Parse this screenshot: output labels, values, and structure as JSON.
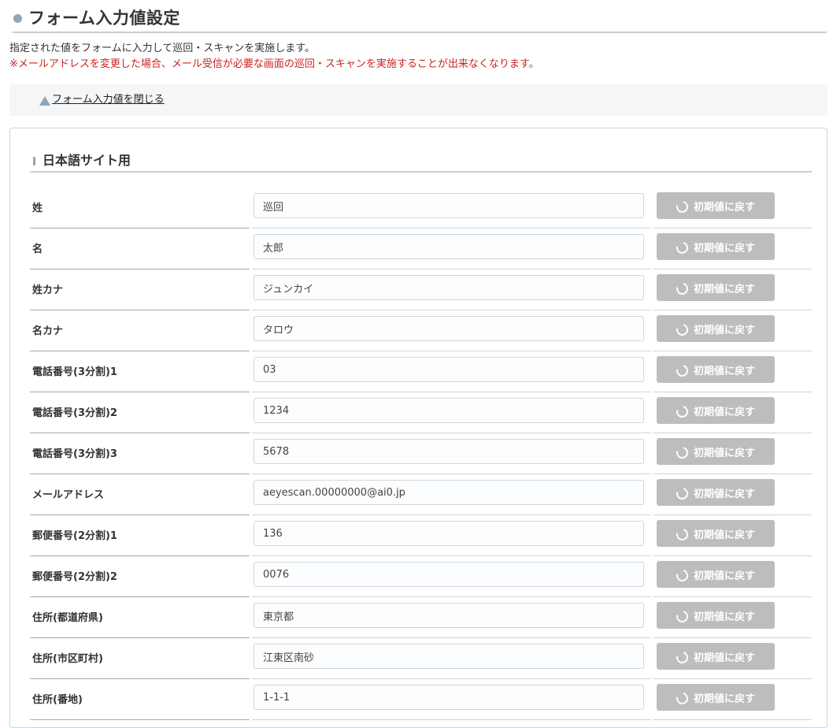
{
  "header": {
    "title": "フォーム入力値設定"
  },
  "description": "指定された値をフォームに入力して巡回・スキャンを実施します。",
  "warning": "※メールアドレスを変更した場合、メール受信が必要な画面の巡回・スキャンを実施することが出来なくなります。",
  "toggle": {
    "label": "フォーム入力値を閉じる"
  },
  "section": {
    "title": "日本語サイト用"
  },
  "reset_label": "初期値に戻す",
  "fields": [
    {
      "label": "姓",
      "value": "巡回"
    },
    {
      "label": "名",
      "value": "太郎"
    },
    {
      "label": "姓カナ",
      "value": "ジュンカイ"
    },
    {
      "label": "名カナ",
      "value": "タロウ"
    },
    {
      "label": "電話番号(3分割)1",
      "value": "03"
    },
    {
      "label": "電話番号(3分割)2",
      "value": "1234"
    },
    {
      "label": "電話番号(3分割)3",
      "value": "5678"
    },
    {
      "label": "メールアドレス",
      "value": "aeyescan.00000000@ai0.jp"
    },
    {
      "label": "郵便番号(2分割)1",
      "value": "136"
    },
    {
      "label": "郵便番号(2分割)2",
      "value": "0076"
    },
    {
      "label": "住所(都道府県)",
      "value": "東京都"
    },
    {
      "label": "住所(市区町村)",
      "value": "江東区南砂"
    },
    {
      "label": "住所(番地)",
      "value": "1-1-1"
    }
  ]
}
